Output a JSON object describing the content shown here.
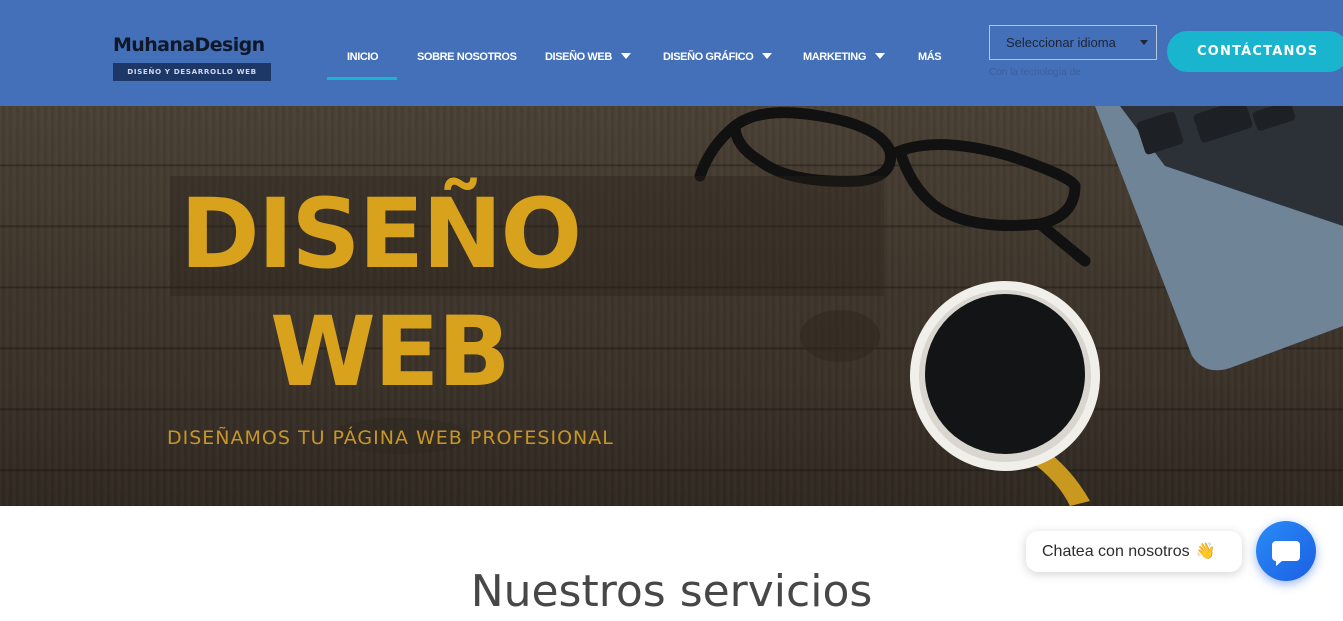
{
  "header": {
    "logo": {
      "name": "MuhanaDesign",
      "tagline": "DISEÑO Y DESARROLLO WEB"
    },
    "nav": [
      {
        "label": "INICIO",
        "active": true,
        "has_dropdown": false
      },
      {
        "label": "SOBRE NOSOTROS",
        "active": false,
        "has_dropdown": false
      },
      {
        "label": "DISEÑO WEB",
        "active": false,
        "has_dropdown": true
      },
      {
        "label": "DISEÑO GRÁFICO",
        "active": false,
        "has_dropdown": true
      },
      {
        "label": "MARKETING",
        "active": false,
        "has_dropdown": true
      },
      {
        "label": "MÁS",
        "active": false,
        "has_dropdown": false
      }
    ],
    "language_select": {
      "selected": "Seleccionar idioma",
      "powered_by": "Con la tecnología de"
    },
    "contact_button": "CONTÁCTANOS"
  },
  "hero": {
    "title_line1": "DISEÑO",
    "title_line2": "WEB",
    "subtitle": "DISEÑAMOS TU PÁGINA WEB PROFESIONAL"
  },
  "content": {
    "section_title": "Nuestros servicios"
  },
  "chat": {
    "bubble_text": "Chatea con nosotros",
    "emoji": "👋"
  },
  "colors": {
    "header_bg": "#4470b9",
    "accent_cyan": "#19b5cf",
    "hero_text_gold": "#d9a21d",
    "chat_blue": "#1b5fe3"
  }
}
